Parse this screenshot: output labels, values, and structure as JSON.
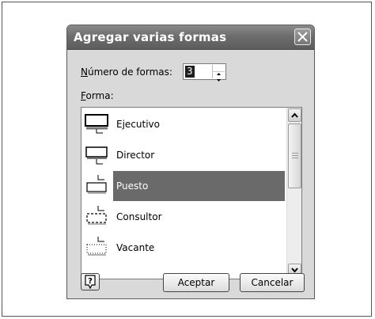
{
  "dialog": {
    "title": "Agregar varias formas",
    "num_label": "Número de formas:",
    "num_value": "3",
    "forma_label": "Forma:",
    "ok_label": "Aceptar",
    "cancel_label": "Cancelar",
    "help_icon": "question-mark-icon"
  },
  "shapes": [
    {
      "label": "Ejecutivo",
      "icon": "executive-shape-icon",
      "selected": false
    },
    {
      "label": "Director",
      "icon": "director-shape-icon",
      "selected": false
    },
    {
      "label": "Puesto",
      "icon": "position-shape-icon",
      "selected": true
    },
    {
      "label": "Consultor",
      "icon": "consultant-shape-icon",
      "selected": false
    },
    {
      "label": "Vacante",
      "icon": "vacancy-shape-icon",
      "selected": false
    }
  ],
  "colors": {
    "selection": "#6a6a6a",
    "titlebar": "#6e6e6e",
    "dialog_bg": "#d9d9d9"
  }
}
